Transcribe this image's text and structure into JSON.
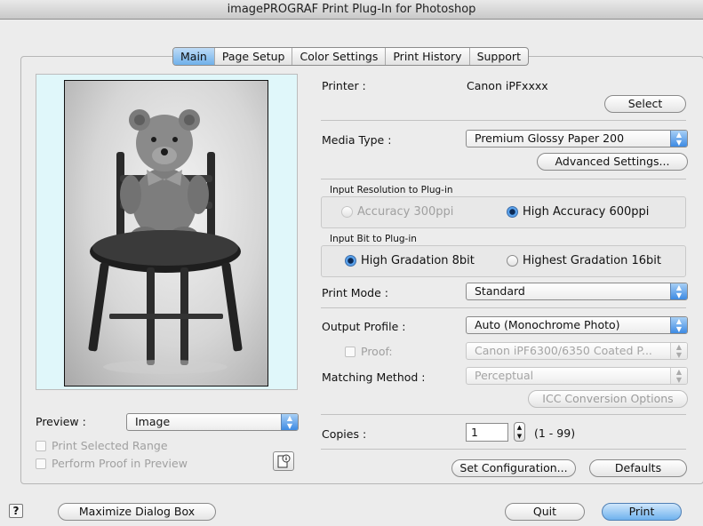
{
  "window": {
    "title": "imagePROGRAF Print Plug-In for Photoshop"
  },
  "tabs": [
    "Main",
    "Page Setup",
    "Color Settings",
    "Print History",
    "Support"
  ],
  "active_tab": "Main",
  "printer": {
    "label": "Printer :",
    "value": "Canon iPFxxxx",
    "select_button": "Select"
  },
  "media": {
    "label": "Media Type :",
    "value": "Premium Glossy Paper 200",
    "advanced_button": "Advanced Settings..."
  },
  "input_resolution": {
    "label": "Input Resolution to Plug-in",
    "options": [
      "Accuracy 300ppi",
      "High Accuracy 600ppi"
    ],
    "selected": "High Accuracy 600ppi"
  },
  "input_bit": {
    "label": "Input Bit to Plug-in",
    "options": [
      "High Gradation 8bit",
      "Highest Gradation 16bit"
    ],
    "selected": "High Gradation 8bit"
  },
  "print_mode": {
    "label": "Print Mode :",
    "value": "Standard"
  },
  "output_profile": {
    "label": "Output Profile :",
    "value": "Auto (Monochrome Photo)"
  },
  "proof": {
    "label": "Proof:",
    "value": "Canon iPF6300/6350 Coated P...",
    "checked": false
  },
  "matching": {
    "label": "Matching Method :",
    "value": "Perceptual",
    "icc_button": "ICC Conversion Options"
  },
  "copies": {
    "label": "Copies :",
    "value": "1",
    "range": "(1 - 99)"
  },
  "config_buttons": {
    "set_configuration": "Set Configuration...",
    "defaults": "Defaults"
  },
  "preview": {
    "label": "Preview :",
    "value": "Image",
    "print_selected_range": "Print Selected Range",
    "perform_proof": "Perform Proof in Preview"
  },
  "bottom": {
    "help": "?",
    "maximize": "Maximize Dialog Box",
    "quit": "Quit",
    "print": "Print"
  }
}
